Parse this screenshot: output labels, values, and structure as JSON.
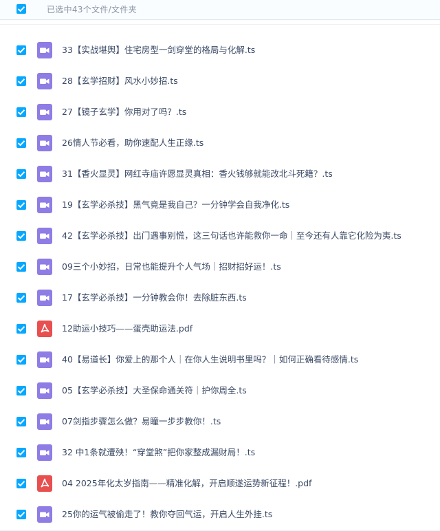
{
  "header": {
    "selection_text": "已选中43个文件/文件夹",
    "checked": true
  },
  "colors": {
    "checkbox": "#06a7ff",
    "video_icon": "#8f7ce4",
    "pdf_icon": "#e84f4f"
  },
  "files": [
    {
      "name": "33【实战堪舆】住宅房型一剑穿堂的格局与化解.ts",
      "type": "video",
      "icon": "video-file-icon",
      "checked": true
    },
    {
      "name": "28【玄学招财】风水小妙招.ts",
      "type": "video",
      "icon": "video-file-icon",
      "checked": true
    },
    {
      "name": "27【镜子玄学】你用对了吗？.ts",
      "type": "video",
      "icon": "video-file-icon",
      "checked": true
    },
    {
      "name": "26情人节必看，助你速配人生正缘.ts",
      "type": "video",
      "icon": "video-file-icon",
      "checked": true
    },
    {
      "name": "31【香火显灵】网红寺庙许愿显灵真相：香火钱够就能改北斗死籍？.ts",
      "type": "video",
      "icon": "video-file-icon",
      "checked": true
    },
    {
      "name": "19【玄学必杀技】黑气竟是我自己？一分钟学会自我净化.ts",
      "type": "video",
      "icon": "video-file-icon",
      "checked": true
    },
    {
      "name": "42【玄学必杀技】出门遇事别慌，这三句话也许能救你一命｜至今还有人靠它化险为夷.ts",
      "type": "video",
      "icon": "video-file-icon",
      "checked": true
    },
    {
      "name": "09三个小妙招，日常也能提升个人气场｜招财招好运！.ts",
      "type": "video",
      "icon": "video-file-icon",
      "checked": true
    },
    {
      "name": "17【玄学必杀技】一分钟教会你！去除脏东西.ts",
      "type": "video",
      "icon": "video-file-icon",
      "checked": true
    },
    {
      "name": "12助运小技巧——蛋壳助运法.pdf",
      "type": "pdf",
      "icon": "pdf-file-icon",
      "checked": true
    },
    {
      "name": "40【易道长】你爱上的那个人｜在你人生说明书里吗？｜如何正确看待感情.ts",
      "type": "video",
      "icon": "video-file-icon",
      "checked": true
    },
    {
      "name": "05【玄学必杀技】大圣保命通关符｜护你周全.ts",
      "type": "video",
      "icon": "video-file-icon",
      "checked": true
    },
    {
      "name": "07剑指步骤怎么做？易瞳一步步教你！.ts",
      "type": "video",
      "icon": "video-file-icon",
      "checked": true
    },
    {
      "name": "32 中1条就遭殃！“穿堂煞”把你家整成漏财局！.ts",
      "type": "video",
      "icon": "video-file-icon",
      "checked": true
    },
    {
      "name": "04 2025年化太岁指南——精准化解，开启顺遂运势新征程！.pdf",
      "type": "pdf",
      "icon": "pdf-file-icon",
      "checked": true
    },
    {
      "name": "25你的运气被偷走了！教你夺回气运，开启人生外挂.ts",
      "type": "video",
      "icon": "video-file-icon",
      "checked": true
    }
  ]
}
